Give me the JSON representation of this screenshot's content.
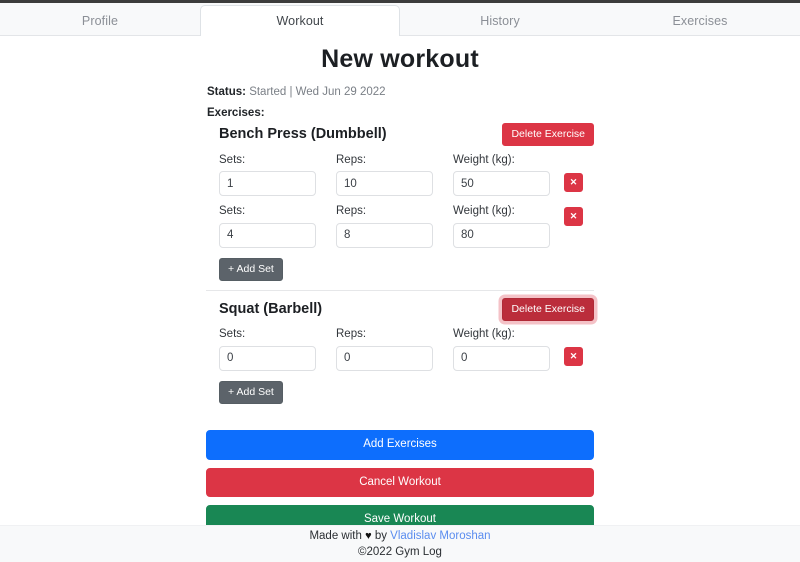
{
  "tabs": [
    {
      "label": "Profile",
      "active": false
    },
    {
      "label": "Workout",
      "active": true
    },
    {
      "label": "History",
      "active": false
    },
    {
      "label": "Exercises",
      "active": false
    }
  ],
  "page": {
    "title": "New workout",
    "status_label": "Status:",
    "status_value": "Started | Wed Jun 29 2022",
    "exercises_label": "Exercises:"
  },
  "labels": {
    "sets": "Sets:",
    "reps": "Reps:",
    "weight": "Weight (kg):",
    "delete_exercise": "Delete Exercise",
    "add_set": "+ Add Set",
    "delete_set_icon": "close-icon",
    "delete_set_glyph": "✕"
  },
  "exercises": [
    {
      "name": "Bench Press (Dumbbell)",
      "delete_focused": false,
      "sets": [
        {
          "sets": "1",
          "reps": "10",
          "weight": "50"
        },
        {
          "sets": "4",
          "reps": "8",
          "weight": "80"
        }
      ]
    },
    {
      "name": "Squat (Barbell)",
      "delete_focused": true,
      "sets": [
        {
          "sets": "0",
          "reps": "0",
          "weight": "0"
        }
      ]
    }
  ],
  "actions": [
    {
      "label": "Add Exercises",
      "style": "btn-primary",
      "name": "add-exercises-button"
    },
    {
      "label": "Cancel Workout",
      "style": "btn-danger",
      "name": "cancel-workout-button"
    },
    {
      "label": "Save Workout",
      "style": "btn-success",
      "name": "save-workout-button"
    }
  ],
  "footer": {
    "made_with": "Made with",
    "heart": "♥",
    "by": "by",
    "author": "Vladislav Moroshan",
    "copyright": "©2022 Gym Log"
  },
  "colors": {
    "primary": "#0d6efd",
    "danger": "#dc3545",
    "success": "#198754",
    "secondary": "#5c636a",
    "link": "#5b8def",
    "page_bg": "#ffffff",
    "chrome_bg": "#f8f9fa"
  }
}
